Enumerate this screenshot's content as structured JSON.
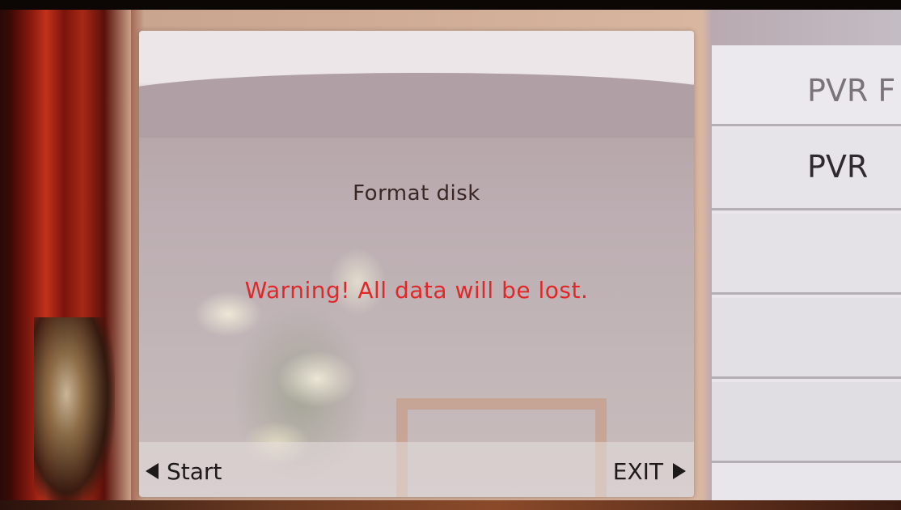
{
  "dialog": {
    "title": "Format disk",
    "warning": "Warning! All data will be lost.",
    "start_label": "Start",
    "exit_label": "EXIT"
  },
  "side_menu": {
    "items": [
      {
        "label": "PVR F"
      },
      {
        "label": "PVR"
      },
      {
        "label": ""
      },
      {
        "label": ""
      },
      {
        "label": ""
      }
    ]
  },
  "icons": {
    "start": "triangle-left-icon",
    "exit": "triangle-right-icon"
  },
  "colors": {
    "warning_text": "#e0282a",
    "title_text": "#3a2624",
    "button_text": "#1e1a1a"
  }
}
